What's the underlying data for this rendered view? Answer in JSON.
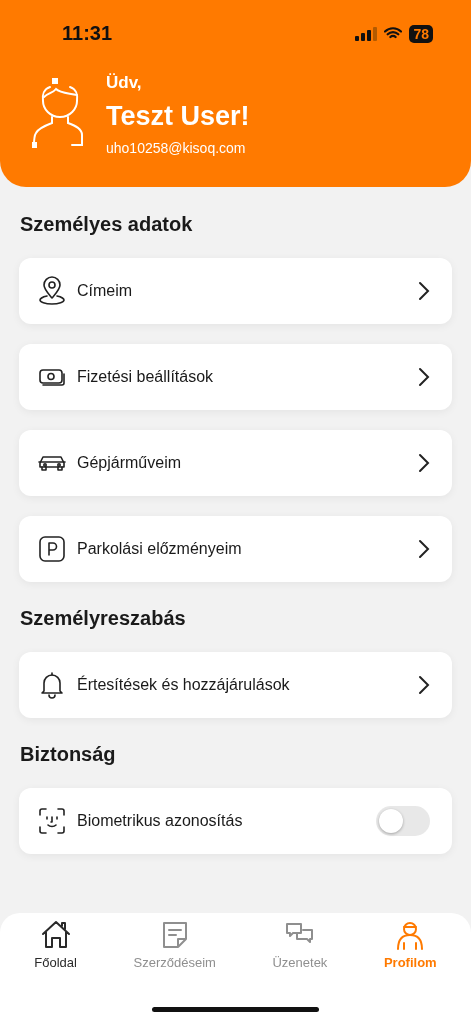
{
  "status_bar": {
    "time": "11:31",
    "battery": "78"
  },
  "header": {
    "greeting": "Üdv,",
    "name": "Teszt User!",
    "email": "uho10258@kisoq.com"
  },
  "sections": [
    {
      "title": "Személyes adatok",
      "items": [
        {
          "kind": "link",
          "label": "Címeim"
        },
        {
          "kind": "link",
          "label": "Fizetési beállítások"
        },
        {
          "kind": "link",
          "label": "Gépjárműveim"
        },
        {
          "kind": "link",
          "label": "Parkolási előzményeim"
        }
      ]
    },
    {
      "title": "Személyreszabás",
      "items": [
        {
          "kind": "link",
          "label": "Értesítések és hozzájárulások"
        }
      ]
    },
    {
      "title": "Biztonság",
      "items": [
        {
          "kind": "toggle",
          "label": "Biometrikus azonosítás",
          "on": false
        }
      ]
    }
  ],
  "tab_bar": [
    {
      "label": "Főoldal",
      "selected": false,
      "disabled": false
    },
    {
      "label": "Szerződéseim",
      "selected": false,
      "disabled": true
    },
    {
      "label": "Üzenetek",
      "selected": false,
      "disabled": true
    },
    {
      "label": "Profilom",
      "selected": true,
      "disabled": false
    }
  ]
}
